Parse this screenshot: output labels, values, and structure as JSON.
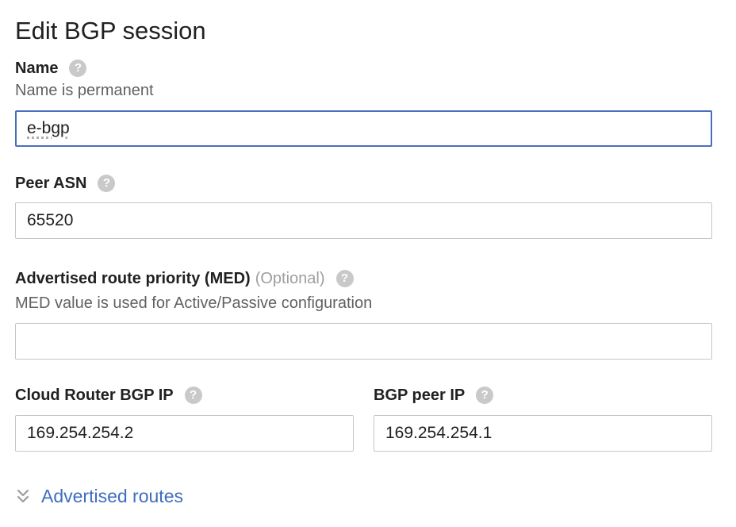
{
  "dialog": {
    "title": "Edit BGP session"
  },
  "name_field": {
    "label": "Name",
    "hint": "Name is permanent",
    "value": "e-bgp",
    "help_icon": "help-circle-icon"
  },
  "peer_asn_field": {
    "label": "Peer ASN",
    "value": "65520",
    "help_icon": "help-circle-icon"
  },
  "med_field": {
    "label": "Advertised route priority (MED)",
    "optional_tag": "(Optional)",
    "hint": "MED value is used for Active/Passive configuration",
    "value": "",
    "help_icon": "help-circle-icon"
  },
  "cloud_router_ip_field": {
    "label": "Cloud Router BGP IP",
    "value": "169.254.254.2",
    "help_icon": "help-circle-icon"
  },
  "bgp_peer_ip_field": {
    "label": "BGP peer IP",
    "value": "169.254.254.1",
    "help_icon": "help-circle-icon"
  },
  "advertised_routes": {
    "label": "Advertised routes",
    "icon": "chevron-double-down-icon"
  },
  "colors": {
    "link": "#3f6dc1",
    "focus_border": "#4a6fbf",
    "help_icon_bg": "#c9c9c9"
  }
}
